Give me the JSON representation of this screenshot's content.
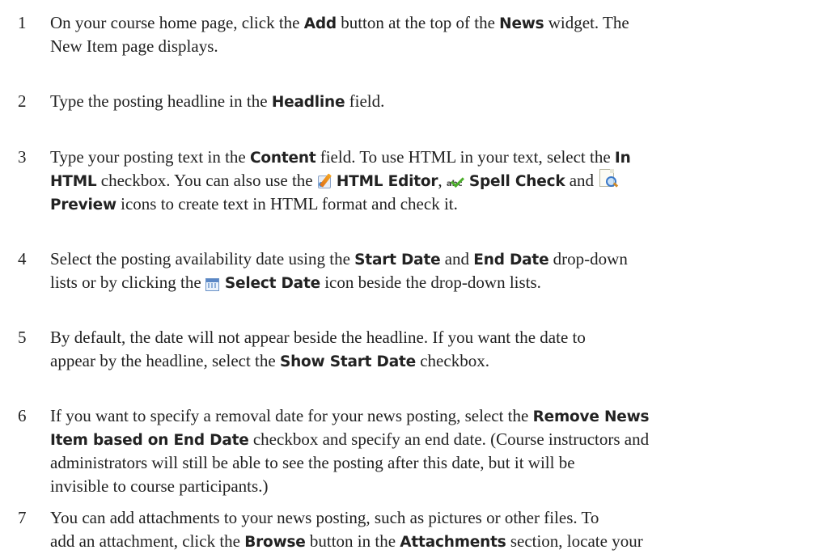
{
  "steps": [
    {
      "number": "1",
      "t1": "On your course home page, click the ",
      "b1": "Add",
      "t2": " button at the top of the ",
      "b2": "News",
      "t3": " widget. The",
      "t4": "New Item page displays."
    },
    {
      "number": "2",
      "t1": "Type the posting headline in the ",
      "b1": "Headline",
      "t2": " field."
    },
    {
      "number": "3",
      "t1": "Type your posting text in the ",
      "b1": "Content",
      "t2": " field. To use HTML in your text, select the ",
      "b2": "In",
      "b3": "HTML",
      "t3": " checkbox. You can also use the ",
      "b4": "HTML Editor",
      "t4": ", ",
      "b5": "Spell Check",
      "t5": " and ",
      "b6": "Preview",
      "t6": " icons to create text in HTML format and check it."
    },
    {
      "number": "4",
      "t1": "Select the posting availability date using the ",
      "b1": "Start Date",
      "t2": " and ",
      "b2": "End Date",
      "t3": " drop-down",
      "t4": "lists or by clicking the ",
      "b3": "Select Date",
      "t5": " icon beside the drop-down lists."
    },
    {
      "number": "5",
      "t1": "By default, the date will not appear beside the headline. If you want the date to",
      "t2": "appear by the headline, select the ",
      "b1": "Show Start Date",
      "t3": " checkbox."
    },
    {
      "number": "6",
      "t1": "If you want to specify a removal date for your news posting, select the ",
      "b1": "Remove News",
      "b2": "Item based on End Date",
      "t2": " checkbox and specify an end date. (Course instructors and",
      "t3": "administrators will still be able to see the posting after this date, but it will be",
      "t4": "invisible to course participants.)"
    },
    {
      "number": "7",
      "t1": "You can add attachments to your news posting, such as pictures or other files. To",
      "t2": "add an attachment, click the ",
      "b1": "Browse",
      "t3": " button in the ",
      "b2": "Attachments",
      "t4": " section, locate your"
    }
  ],
  "icons": {
    "html_editor": "html-editor-icon",
    "spell_check": "spell-check-icon",
    "preview": "preview-icon",
    "select_date": "calendar-icon"
  }
}
